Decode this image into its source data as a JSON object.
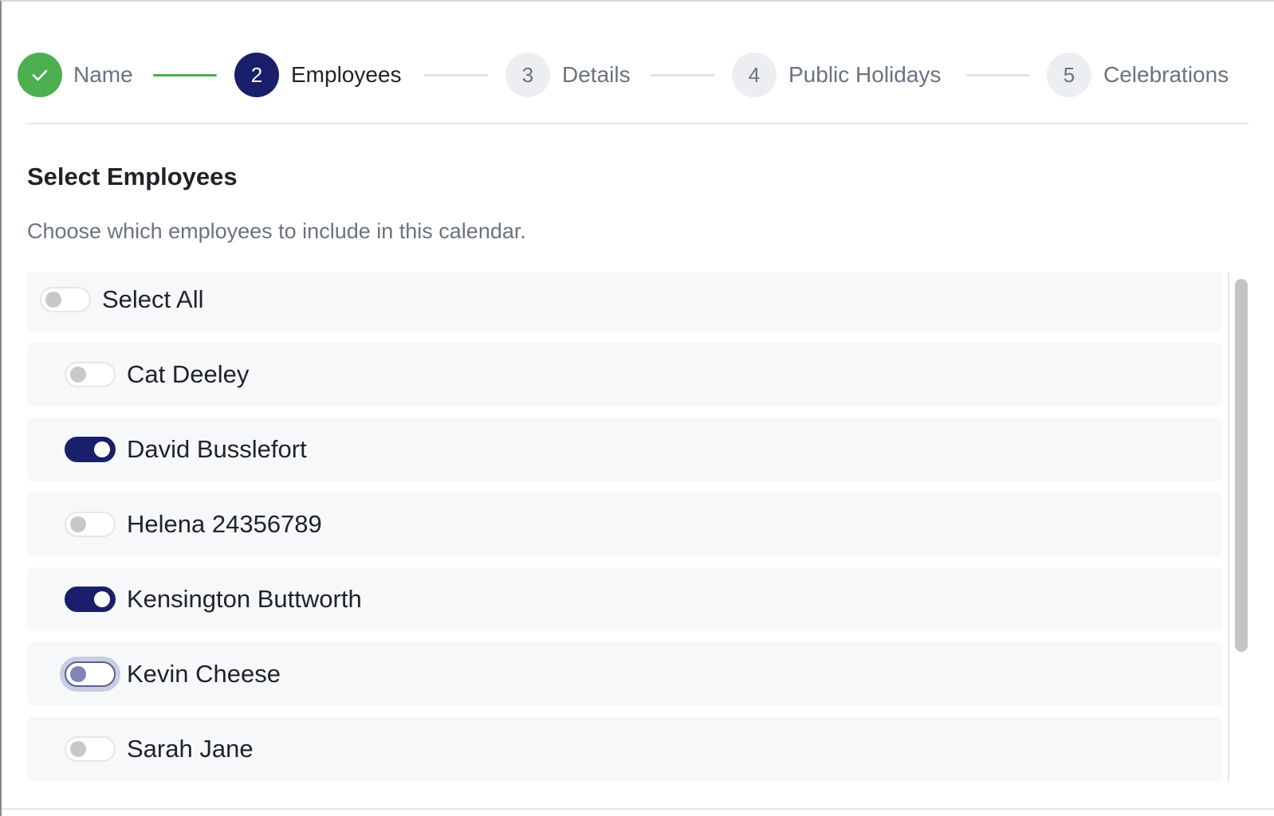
{
  "stepper": {
    "steps": [
      {
        "number": "1",
        "label": "Name",
        "state": "done",
        "icon": "check-icon"
      },
      {
        "number": "2",
        "label": "Employees",
        "state": "active"
      },
      {
        "number": "3",
        "label": "Details",
        "state": "todo"
      },
      {
        "number": "4",
        "label": "Public Holidays",
        "state": "todo"
      },
      {
        "number": "5",
        "label": "Celebrations",
        "state": "todo"
      }
    ]
  },
  "section": {
    "title": "Select Employees",
    "description": "Choose which employees to include in this calendar."
  },
  "employees": {
    "select_all_label": "Select All",
    "select_all_on": false,
    "items": [
      {
        "name": "Cat Deeley",
        "on": false
      },
      {
        "name": "David Busslefort",
        "on": true
      },
      {
        "name": "Helena 24356789",
        "on": false
      },
      {
        "name": "Kensington Buttworth",
        "on": true
      },
      {
        "name": "Kevin Cheese",
        "on": false,
        "focused": true
      },
      {
        "name": "Sarah Jane",
        "on": false
      }
    ]
  },
  "colors": {
    "accent": "#1a1f6b",
    "success": "#4caf50",
    "muted_text": "#6b7280",
    "row_bg": "#f7f8fa"
  }
}
